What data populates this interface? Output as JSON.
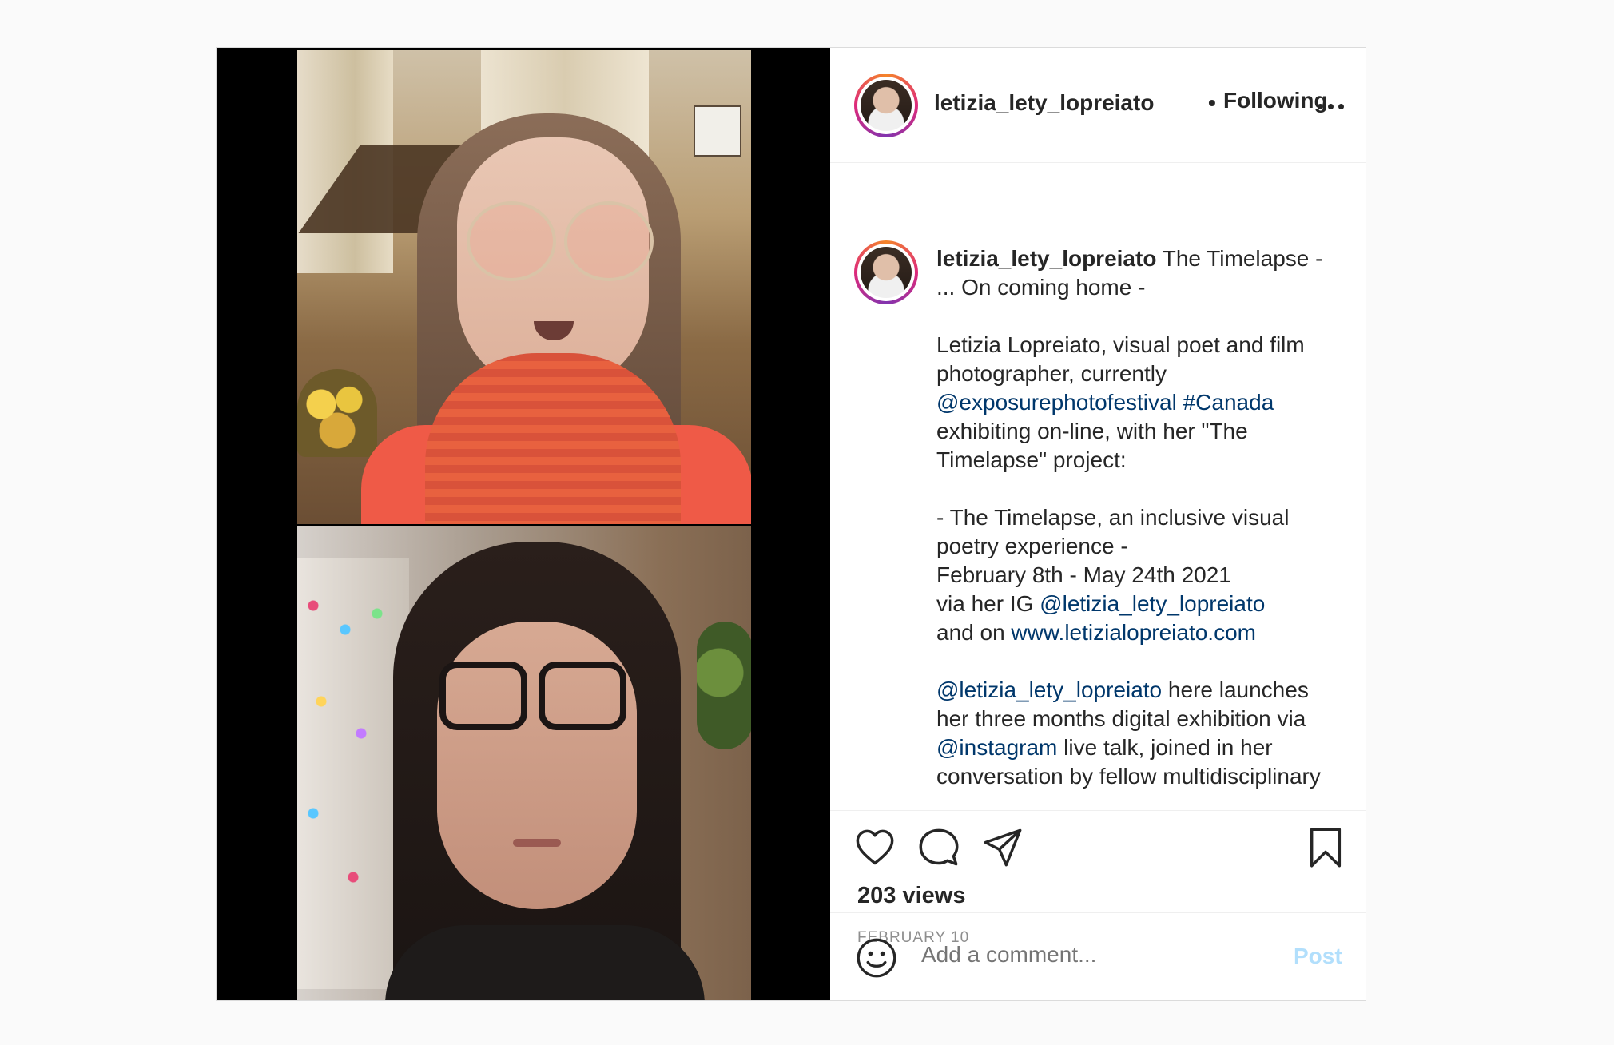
{
  "post": {
    "username": "letizia_lety_lopreiato",
    "separator": "•",
    "follow_status": "Following",
    "caption": {
      "username": "letizia_lety_lopreiato",
      "lines": [
        " The Timelapse -",
        "... On coming home -",
        "Letizia Lopreiato, visual poet and film",
        "photographer, currently",
        "@exposurephotofestival",
        "#Canada",
        "exhibiting on-line, with her \"The",
        "Timelapse\" project:",
        "- The Timelapse, an inclusive visual",
        "poetry experience -",
        "February 8th - May 24th 2021",
        "via her IG ",
        "@letizia_lety_lopreiato",
        "and on ",
        "www.letizialopreiato.com",
        "@letizia_lety_lopreiato",
        " here launches",
        "her three months digital exhibition via",
        "@instagram",
        " live talk, joined in her",
        "conversation by fellow multidisciplinary"
      ]
    },
    "views": "203 views",
    "date": "FEBRUARY 10",
    "comment_placeholder": "Add a comment...",
    "post_label": "Post",
    "colors": {
      "link": "#00376b",
      "post_button": "#b2dffc",
      "muted": "#8e8e8e"
    },
    "icons": [
      "heart-icon",
      "comment-icon",
      "share-icon",
      "bookmark-icon",
      "more-options-icon",
      "emoji-icon"
    ]
  }
}
